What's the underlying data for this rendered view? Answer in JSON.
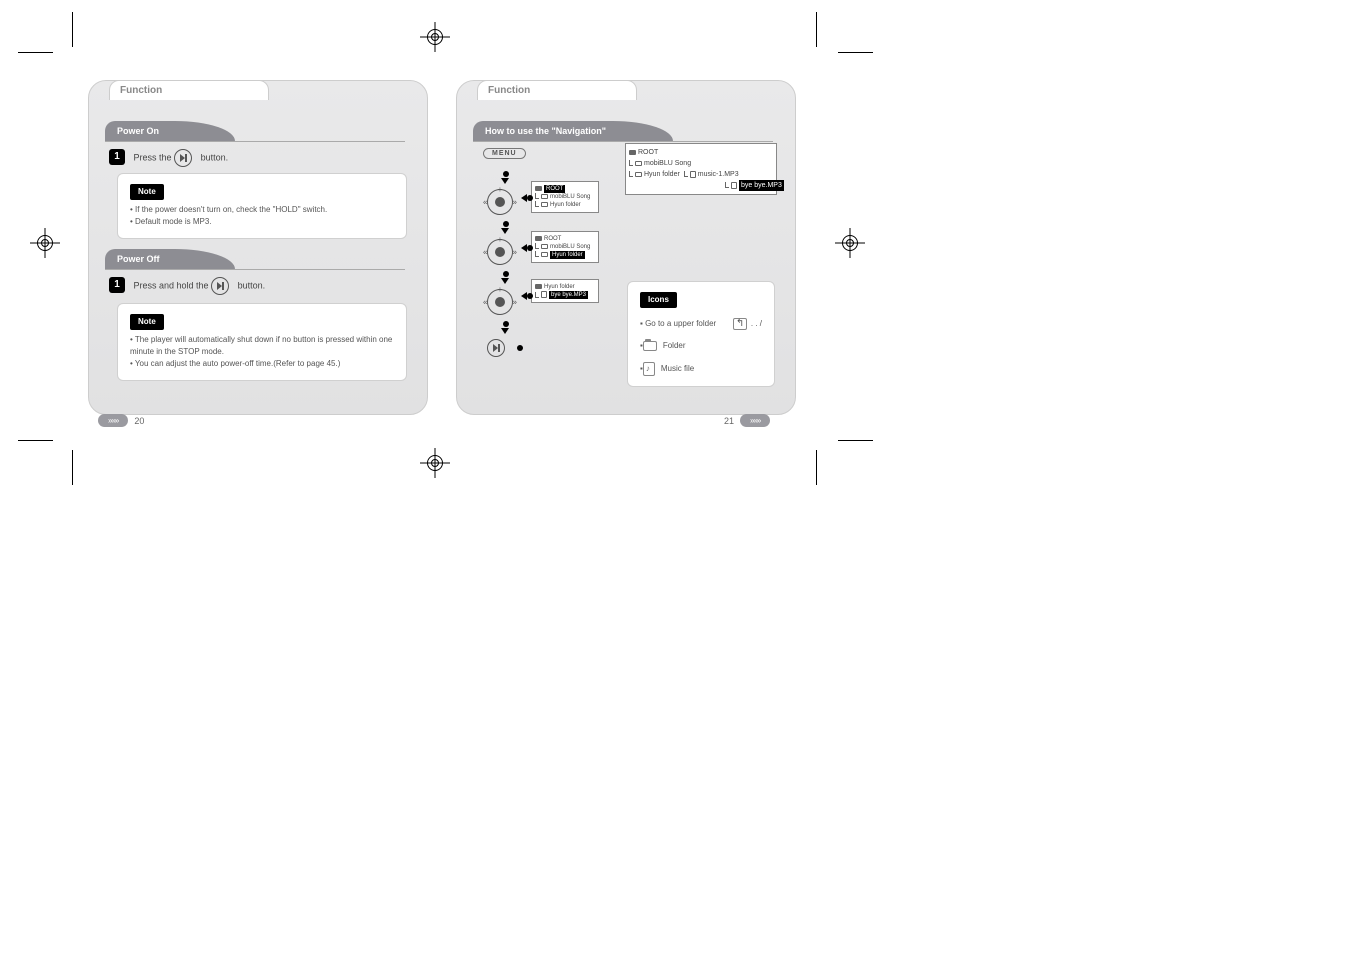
{
  "left": {
    "tab": "Function",
    "sec1": {
      "title": "Power On",
      "step1": {
        "num": "1",
        "text_a": "Press the ",
        "text_b": " button."
      },
      "note_label": "Note",
      "note1": "If the power doesn't turn on, check the \"HOLD\" switch.",
      "note2": "Default mode is MP3."
    },
    "sec2": {
      "title": "Power Off",
      "step1": {
        "num": "1",
        "text_a": "Press and hold the ",
        "text_b": " button."
      },
      "note_label": "Note",
      "note1": "The player will automatically shut down if no button is pressed within one minute in the STOP mode.",
      "note2": "You can adjust the auto power-off time.(Refer to page 45.)"
    },
    "page": "20"
  },
  "right": {
    "tab": "Function",
    "title": "How to use the \"Navigation\"",
    "menu_btn": "MENU",
    "scr_root": "ROOT",
    "scr_mobi": "mobiBLU Song",
    "scr_hyun": "Hyun folder",
    "scr_music1": "music-1.MP3",
    "scr_bye": "bye bye.MP3",
    "legend": {
      "title": "Icons",
      "up_label": "Go to a upper folder",
      "up_glyph": ". . /",
      "folder_label": "Folder",
      "file_label": "Music file"
    },
    "page": "21"
  }
}
